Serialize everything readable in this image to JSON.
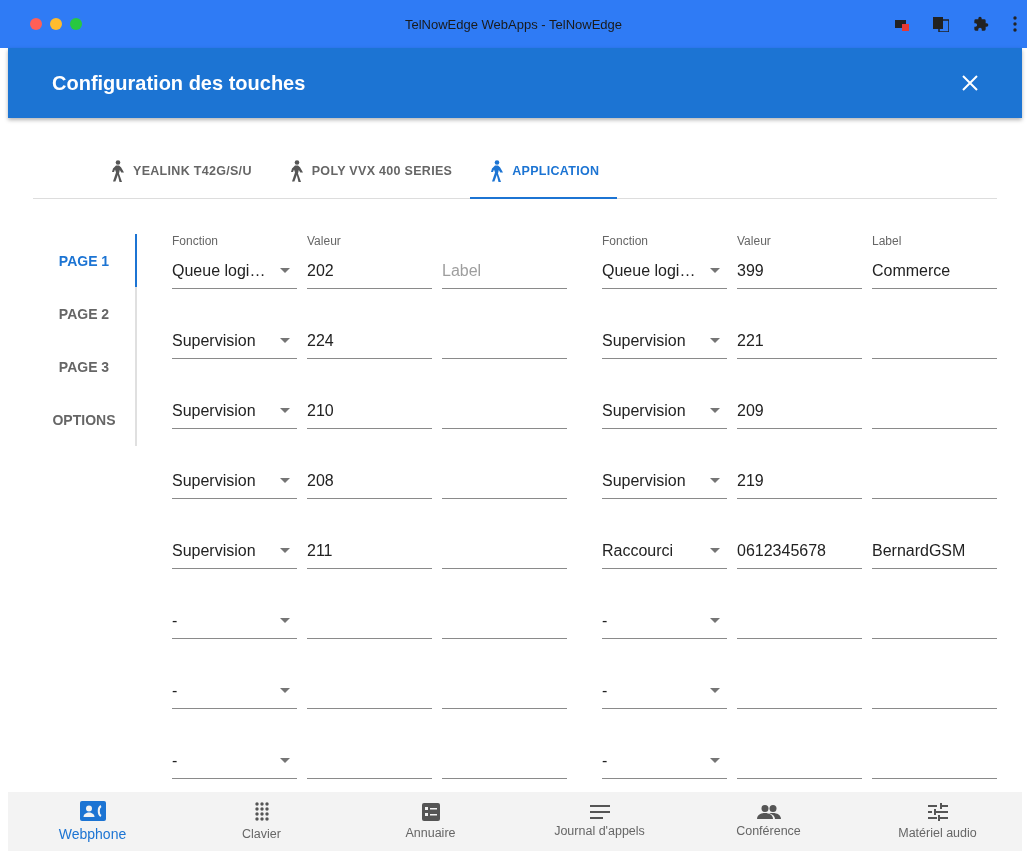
{
  "browser": {
    "title": "TelNowEdge WebApps - TelNowEdge"
  },
  "dialog": {
    "title": "Configuration des touches"
  },
  "tabs": [
    {
      "label": "YEALINK T42G/S/U",
      "selected": false
    },
    {
      "label": "POLY VVX 400 SERIES",
      "selected": false
    },
    {
      "label": "APPLICATION",
      "selected": true
    }
  ],
  "pages": [
    {
      "label": "PAGE 1",
      "selected": true
    },
    {
      "label": "PAGE 2",
      "selected": false
    },
    {
      "label": "PAGE 3",
      "selected": false
    },
    {
      "label": "OPTIONS",
      "selected": false
    }
  ],
  "columns": [
    {
      "rows": [
        {
          "function": {
            "label": "Fonction",
            "value": "Queue logi…"
          },
          "value": {
            "label": "Valeur",
            "value": "202"
          },
          "label": {
            "placeholder": "Label"
          }
        },
        {
          "function": {
            "value": "Supervision"
          },
          "value": {
            "value": "224"
          },
          "label": {}
        },
        {
          "function": {
            "value": "Supervision"
          },
          "value": {
            "value": "210"
          },
          "label": {}
        },
        {
          "function": {
            "value": "Supervision"
          },
          "value": {
            "value": "208"
          },
          "label": {}
        },
        {
          "function": {
            "value": "Supervision"
          },
          "value": {
            "value": "211"
          },
          "label": {}
        },
        {
          "function": {
            "value": "-"
          },
          "value": {},
          "label": {}
        },
        {
          "function": {
            "value": "-"
          },
          "value": {},
          "label": {}
        },
        {
          "function": {
            "value": "-"
          },
          "value": {},
          "label": {}
        }
      ]
    },
    {
      "rows": [
        {
          "function": {
            "label": "Fonction",
            "value": "Queue logi…"
          },
          "value": {
            "label": "Valeur",
            "value": "399"
          },
          "label": {
            "label": "Label",
            "value": "Commerce"
          }
        },
        {
          "function": {
            "value": "Supervision"
          },
          "value": {
            "value": "221"
          },
          "label": {}
        },
        {
          "function": {
            "value": "Supervision"
          },
          "value": {
            "value": "209"
          },
          "label": {}
        },
        {
          "function": {
            "value": "Supervision"
          },
          "value": {
            "value": "219"
          },
          "label": {}
        },
        {
          "function": {
            "value": "Raccourci"
          },
          "value": {
            "value": "0612345678"
          },
          "label": {
            "value": "BernardGSM"
          }
        },
        {
          "function": {
            "value": "-"
          },
          "value": {},
          "label": {}
        },
        {
          "function": {
            "value": "-"
          },
          "value": {},
          "label": {}
        },
        {
          "function": {
            "value": "-"
          },
          "value": {},
          "label": {}
        }
      ]
    }
  ],
  "bottom_nav": [
    {
      "label": "Webphone",
      "selected": true
    },
    {
      "label": "Clavier",
      "selected": false
    },
    {
      "label": "Annuaire",
      "selected": false
    },
    {
      "label": "Journal d'appels",
      "selected": false
    },
    {
      "label": "Conférence",
      "selected": false
    },
    {
      "label": "Matériel audio",
      "selected": false
    }
  ]
}
